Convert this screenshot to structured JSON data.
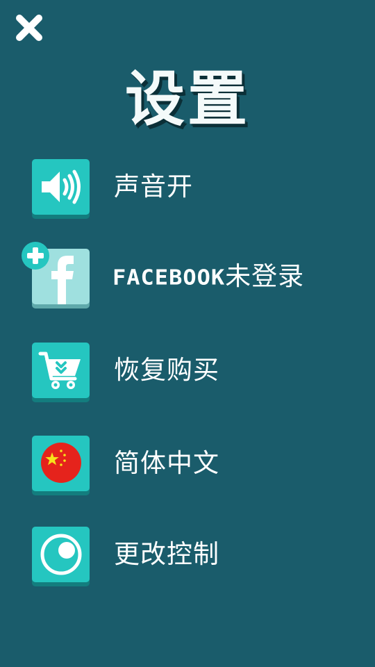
{
  "header": {
    "title": "设置"
  },
  "menu": {
    "items": [
      {
        "id": "sound",
        "label": "声音开",
        "icon": "speaker-icon"
      },
      {
        "id": "facebook",
        "label_brand": "FACEBOOK",
        "label_suffix": "未登录",
        "icon": "facebook-icon"
      },
      {
        "id": "restore",
        "label": "恢复购买",
        "icon": "cart-icon"
      },
      {
        "id": "language",
        "label": "简体中文",
        "icon": "china-flag-icon"
      },
      {
        "id": "controls",
        "label": "更改控制",
        "icon": "control-knob-icon"
      }
    ]
  },
  "colors": {
    "background": "#1a5c6b",
    "tile": "#25c6c0",
    "tile_shadow": "#137d7e",
    "tile_facebook": "#9fe0df",
    "text": "#ffffff",
    "flag_red": "#e5231c",
    "flag_star": "#f7e21b"
  }
}
